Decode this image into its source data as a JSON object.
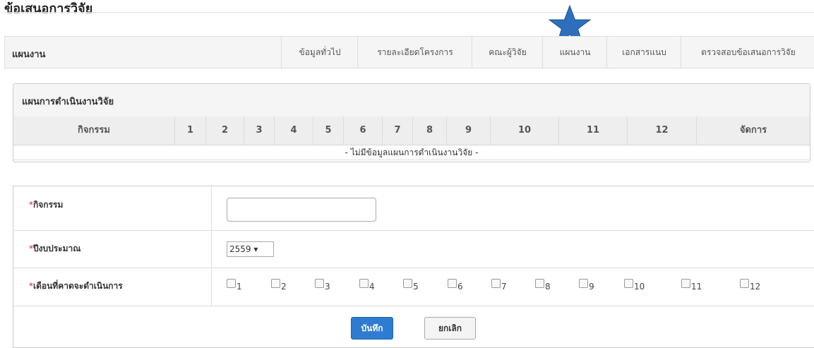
{
  "page": {
    "title": "ข้อเสนอการวิจัย"
  },
  "tabbar": {
    "title": "แผนงาน",
    "tabs": [
      {
        "label": "ข้อมูลทั่วไป"
      },
      {
        "label": "รายละเอียดโครงการ"
      },
      {
        "label": "คณะผู้วิจัย"
      },
      {
        "label": "แผนงาน"
      },
      {
        "label": "เอกสารแนบ"
      },
      {
        "label": "ตรวจสอบข้อเสนอการวิจัย"
      }
    ]
  },
  "plan": {
    "title": "แผนการดำเนินงานวิจัย",
    "columns": [
      "กิจกรรม",
      "1",
      "2",
      "3",
      "4",
      "5",
      "6",
      "7",
      "8",
      "9",
      "10",
      "11",
      "12",
      "จัดการ"
    ],
    "empty_message": "- ไม่มีข้อมูลแผนการดำเนินงานวิจัย -"
  },
  "form": {
    "required_mark": "*",
    "activity": {
      "label": "กิจกรรม",
      "value": ""
    },
    "budget_year": {
      "label": "ปีงบประมาณ",
      "selected": "2559 ▾"
    },
    "months": {
      "label": "เดือนที่คาดจะดำเนินการ",
      "options": [
        "1",
        "2",
        "3",
        "4",
        "5",
        "6",
        "7",
        "8",
        "9",
        "10",
        "11",
        "12"
      ]
    },
    "save_label": "บันทึก",
    "cancel_label": "ยกเลิก"
  },
  "colors": {
    "accent": "#2e7cd1",
    "required": "#e02020",
    "star": "#2e6fbd"
  },
  "icons": {
    "marker": "star-icon"
  }
}
